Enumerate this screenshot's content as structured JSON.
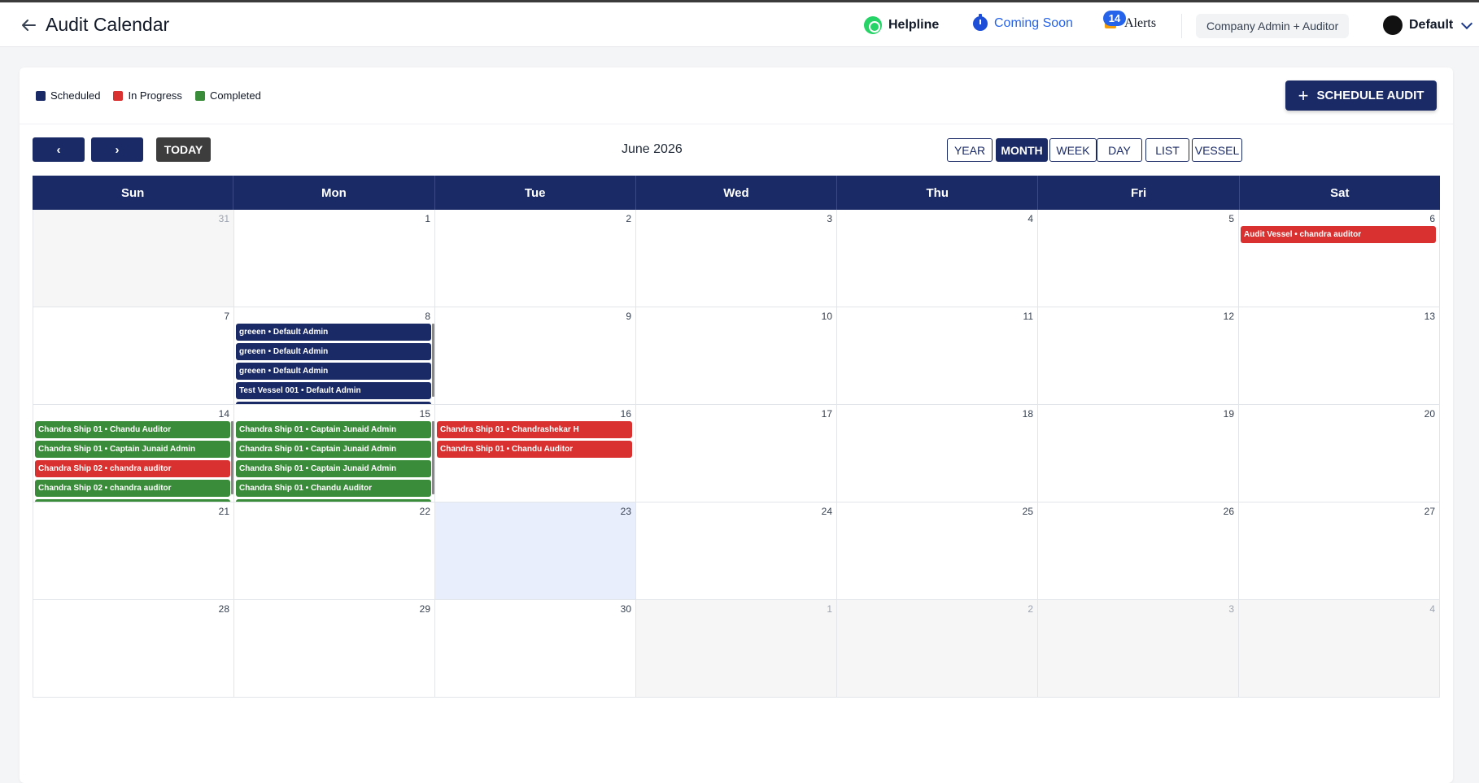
{
  "header": {
    "title": "Audit Calendar",
    "helpline": "Helpline",
    "coming_soon": "Coming Soon",
    "alerts_label": "Alerts",
    "alerts_count": "14",
    "role": "Company Admin + Auditor",
    "user": "Default"
  },
  "legend": [
    {
      "label": "Scheduled",
      "color": "#1a2a66"
    },
    {
      "label": "In Progress",
      "color": "#d93030"
    },
    {
      "label": "Completed",
      "color": "#3a8b3a"
    }
  ],
  "toolbar": {
    "schedule_label": "SCHEDULE AUDIT",
    "prev_label": "‹",
    "next_label": "›",
    "today_label": "TODAY",
    "month_title": "June 2026",
    "views": [
      "YEAR",
      "MONTH",
      "WEEK",
      "DAY",
      "LIST",
      "VESSEL"
    ],
    "active_view": "MONTH"
  },
  "calendar": {
    "weekdays": [
      "Sun",
      "Mon",
      "Tue",
      "Wed",
      "Thu",
      "Fri",
      "Sat"
    ],
    "status_colors": {
      "scheduled": "#1a2a66",
      "in_progress": "#d93030",
      "completed": "#3a8b3a"
    },
    "weeks": [
      [
        {
          "day": "31",
          "other": true,
          "events": []
        },
        {
          "day": "1",
          "events": []
        },
        {
          "day": "2",
          "events": []
        },
        {
          "day": "3",
          "events": []
        },
        {
          "day": "4",
          "events": []
        },
        {
          "day": "5",
          "events": []
        },
        {
          "day": "6",
          "events": [
            {
              "title": "Audit Vessel • chandra auditor",
              "status": "in_progress"
            }
          ]
        }
      ],
      [
        {
          "day": "7",
          "events": []
        },
        {
          "day": "8",
          "scroll": true,
          "events": [
            {
              "title": "greeen • Default Admin",
              "status": "scheduled"
            },
            {
              "title": "greeen • Default Admin",
              "status": "scheduled"
            },
            {
              "title": "greeen • Default Admin",
              "status": "scheduled"
            },
            {
              "title": "Test Vessel 001 • Default Admin",
              "status": "scheduled"
            },
            {
              "title": "",
              "status": "scheduled"
            }
          ]
        },
        {
          "day": "9",
          "events": []
        },
        {
          "day": "10",
          "events": []
        },
        {
          "day": "11",
          "events": []
        },
        {
          "day": "12",
          "events": []
        },
        {
          "day": "13",
          "events": []
        }
      ],
      [
        {
          "day": "14",
          "scroll": true,
          "events": [
            {
              "title": "Chandra Ship 01 • Chandu Auditor",
              "status": "completed"
            },
            {
              "title": "Chandra Ship 01 • Captain Junaid Admin",
              "status": "completed"
            },
            {
              "title": "Chandra Ship 02 • chandra auditor",
              "status": "in_progress"
            },
            {
              "title": "Chandra Ship 02 • chandra auditor",
              "status": "completed"
            },
            {
              "title": "",
              "status": "completed"
            }
          ]
        },
        {
          "day": "15",
          "scroll": true,
          "events": [
            {
              "title": "Chandra Ship 01 • Captain Junaid Admin",
              "status": "completed"
            },
            {
              "title": "Chandra Ship 01 • Captain Junaid Admin",
              "status": "completed"
            },
            {
              "title": "Chandra Ship 01 • Captain Junaid Admin",
              "status": "completed"
            },
            {
              "title": "Chandra Ship 01 • Chandu Auditor",
              "status": "completed"
            },
            {
              "title": "",
              "status": "completed"
            }
          ]
        },
        {
          "day": "16",
          "events": [
            {
              "title": "Chandra Ship 01 • Chandrashekar H",
              "status": "in_progress"
            },
            {
              "title": "Chandra Ship 01 • Chandu Auditor",
              "status": "in_progress"
            }
          ]
        },
        {
          "day": "17",
          "events": []
        },
        {
          "day": "18",
          "events": []
        },
        {
          "day": "19",
          "events": []
        },
        {
          "day": "20",
          "events": []
        }
      ],
      [
        {
          "day": "21",
          "events": []
        },
        {
          "day": "22",
          "events": []
        },
        {
          "day": "23",
          "today": true,
          "events": []
        },
        {
          "day": "24",
          "events": []
        },
        {
          "day": "25",
          "events": []
        },
        {
          "day": "26",
          "events": []
        },
        {
          "day": "27",
          "events": []
        }
      ],
      [
        {
          "day": "28",
          "events": []
        },
        {
          "day": "29",
          "events": []
        },
        {
          "day": "30",
          "events": []
        },
        {
          "day": "1",
          "other": true,
          "events": []
        },
        {
          "day": "2",
          "other": true,
          "events": []
        },
        {
          "day": "3",
          "other": true,
          "events": []
        },
        {
          "day": "4",
          "other": true,
          "events": []
        }
      ]
    ]
  }
}
